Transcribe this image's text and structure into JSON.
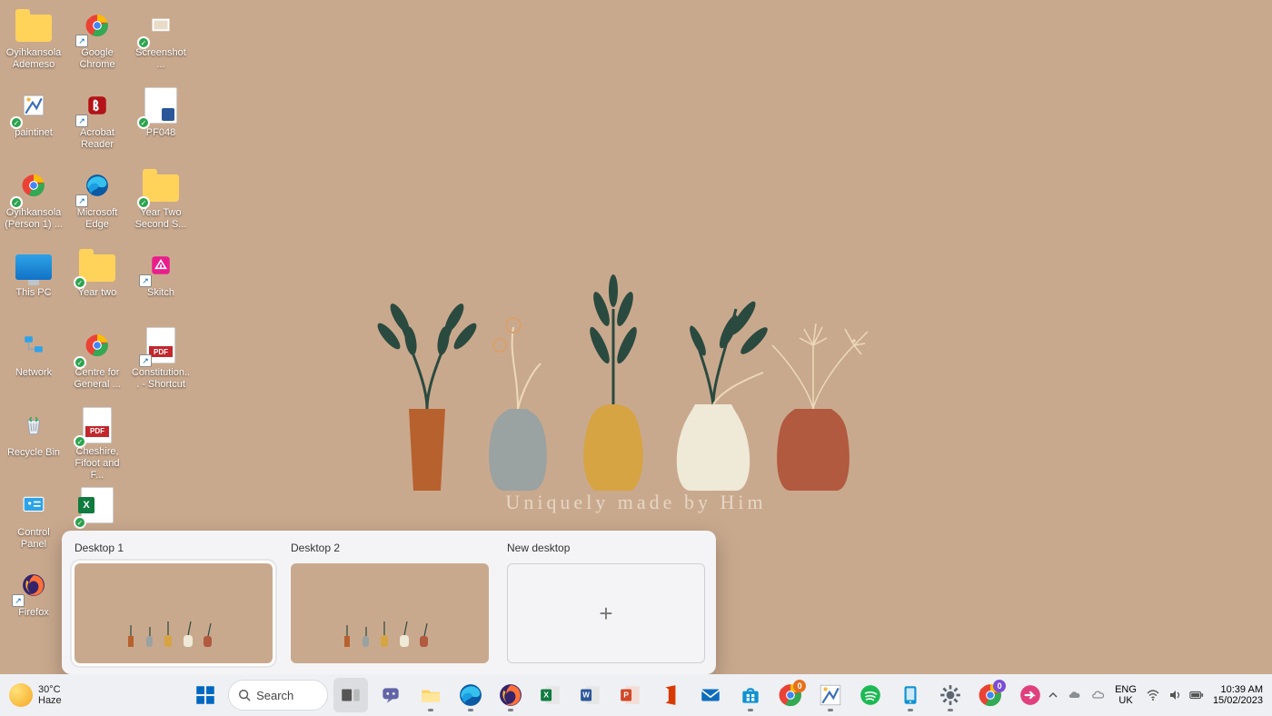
{
  "wallpaper_text": "Uniquely made by Him",
  "desktop_icons": [
    {
      "label": "Oyihkansola Ademeso",
      "kind": "folder"
    },
    {
      "label": "Google Chrome",
      "kind": "chrome",
      "shortcut": true
    },
    {
      "label": "Screenshot ...",
      "kind": "screenshot",
      "sync": true
    },
    {
      "label": "paintinet",
      "kind": "paintnet",
      "sync": true
    },
    {
      "label": "Acrobat Reader",
      "kind": "acrobat",
      "shortcut": true
    },
    {
      "label": "PF048",
      "kind": "doc",
      "sync": true
    },
    {
      "label": "Oyihkansola (Person 1) ...",
      "kind": "chrome",
      "sync": true
    },
    {
      "label": "Microsoft Edge",
      "kind": "edge",
      "shortcut": true
    },
    {
      "label": "Year Two Second S...",
      "kind": "folder",
      "sync": true
    },
    {
      "label": "This PC",
      "kind": "monitor"
    },
    {
      "label": "Year two",
      "kind": "folder",
      "sync": true
    },
    {
      "label": "Skitch",
      "kind": "skitch",
      "shortcut": true
    },
    {
      "label": "Network",
      "kind": "network"
    },
    {
      "label": "Centre for General ...",
      "kind": "chrome",
      "sync": true
    },
    {
      "label": "Constitution... - Shortcut",
      "kind": "pdf",
      "shortcut": true
    },
    {
      "label": "Recycle Bin",
      "kind": "recycle"
    },
    {
      "label": "Cheshire, Fifoot and F...",
      "kind": "pdf",
      "sync": true
    },
    {
      "label": "",
      "kind": "blank"
    },
    {
      "label": "Control Panel",
      "kind": "control"
    },
    {
      "label": "",
      "kind": "excel",
      "sync": true
    },
    {
      "label": "",
      "kind": "blank"
    },
    {
      "label": "Firefox",
      "kind": "firefox",
      "shortcut": true
    }
  ],
  "task_view": {
    "items": [
      {
        "label": "Desktop 1",
        "active": true
      },
      {
        "label": "Desktop 2",
        "active": false
      }
    ],
    "new_label": "New desktop"
  },
  "taskbar": {
    "weather": {
      "temp": "30°C",
      "desc": "Haze"
    },
    "search_placeholder": "Search",
    "apps": [
      {
        "name": "start",
        "title": "Start"
      },
      {
        "name": "search",
        "title": "Search"
      },
      {
        "name": "task-view",
        "title": "Task View",
        "active": true
      },
      {
        "name": "chat",
        "title": "Chat"
      },
      {
        "name": "file-explorer",
        "title": "File Explorer",
        "running": true
      },
      {
        "name": "edge",
        "title": "Microsoft Edge",
        "running": true
      },
      {
        "name": "firefox",
        "title": "Firefox",
        "running": true
      },
      {
        "name": "excel",
        "title": "Excel"
      },
      {
        "name": "word",
        "title": "Word"
      },
      {
        "name": "powerpoint",
        "title": "PowerPoint"
      },
      {
        "name": "office",
        "title": "Office"
      },
      {
        "name": "mail",
        "title": "Mail"
      },
      {
        "name": "store",
        "title": "Microsoft Store",
        "running": true
      },
      {
        "name": "chrome",
        "title": "Google Chrome",
        "badge": "0"
      },
      {
        "name": "paintnet",
        "title": "paint.net",
        "running": true
      },
      {
        "name": "spotify",
        "title": "Spotify"
      },
      {
        "name": "phone-link",
        "title": "Phone Link",
        "running": true
      },
      {
        "name": "settings",
        "title": "Settings",
        "running": true
      },
      {
        "name": "chrome-profile",
        "title": "Chrome",
        "badge": "0",
        "badge_color": "purple"
      },
      {
        "name": "app-pink",
        "title": "App"
      }
    ],
    "lang": {
      "line1": "ENG",
      "line2": "UK"
    },
    "clock": {
      "time": "10:39 AM",
      "date": "15/02/2023"
    }
  }
}
